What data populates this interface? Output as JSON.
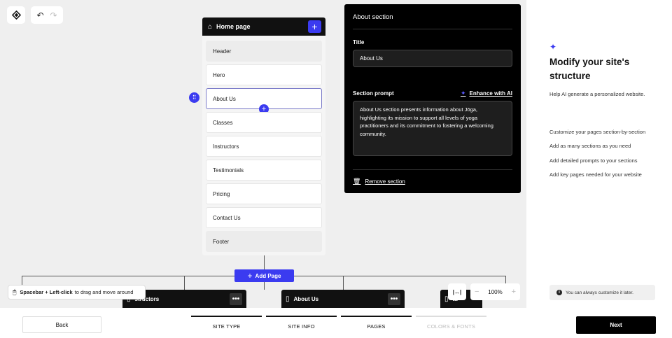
{
  "toolbar": {
    "logo_icon": "diamond-logo-icon",
    "undo_icon": "↶",
    "redo_icon": "↷"
  },
  "page_card": {
    "title": "Home page",
    "home_icon": "⌂",
    "add_icon": "+",
    "sections": [
      {
        "label": "Header"
      },
      {
        "label": "Hero"
      },
      {
        "label": "About Us"
      },
      {
        "label": "Classes"
      },
      {
        "label": "Instructors"
      },
      {
        "label": "Testimonials"
      },
      {
        "label": "Pricing"
      },
      {
        "label": "Contact Us"
      },
      {
        "label": "Footer"
      }
    ]
  },
  "add_page": {
    "icon": "+",
    "label": "Add Page"
  },
  "sub_pages": [
    {
      "name": "Instructors",
      "visible_name": "structors",
      "dots": "•••"
    },
    {
      "name": "About Us",
      "visible_name": "About Us",
      "dots": "•••"
    },
    {
      "name": "",
      "visible_name": "ta",
      "dots": ""
    }
  ],
  "hint": {
    "bold": "Spacebar + Left-click",
    "rest": "to drag and move around"
  },
  "zoom": {
    "fit_label": "|↔|",
    "minus": "−",
    "level": "100%",
    "plus": "+"
  },
  "editor": {
    "title": "About section",
    "title_label": "Title",
    "title_value": "About Us",
    "prompt_label": "Section prompt",
    "enhance_label": "Enhance with AI",
    "prompt_value": "About Us section presents information about Jōga, highlighting its mission to support all levels of yoga practitioners and its commitment to fostering a welcoming community.",
    "remove_label": "Remove section"
  },
  "right_panel": {
    "heading": "Modify your site's structure",
    "subheading": "Help AI generate a personalized website.",
    "features": [
      "Customize your pages section-by-section",
      "Add as many sections as you need",
      "Add detailed prompts to your sections",
      "Add key pages needed for your website"
    ],
    "tip": "You can always customize it later."
  },
  "footer": {
    "back": "Back",
    "steps": [
      "SITE TYPE",
      "SITE INFO",
      "PAGES",
      "COLORS & FONTS"
    ],
    "next": "Next"
  },
  "colors": {
    "accent": "#3b3bf0",
    "dark": "#000000"
  }
}
